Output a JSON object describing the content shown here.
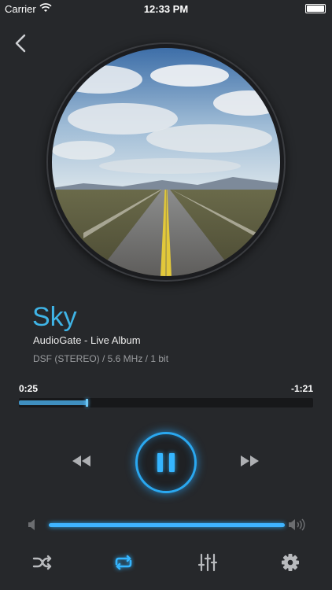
{
  "status_bar": {
    "carrier": "Carrier",
    "time": "12:33 PM",
    "wifi_icon": "wifi-icon",
    "battery_icon": "battery-icon"
  },
  "nav": {
    "back_icon": "chevron-left-icon"
  },
  "track": {
    "title": "Sky",
    "album": "AudioGate - Live Album",
    "format": "DSF (STEREO) / 5.6 MHz / 1 bit"
  },
  "playback": {
    "elapsed": "0:25",
    "remaining": "-1:21",
    "progress_fraction": 0.23,
    "state_icon": "pause-icon"
  },
  "volume": {
    "level_fraction": 1.0
  },
  "controls": {
    "rewind_icon": "rewind-icon",
    "forward_icon": "fast-forward-icon",
    "shuffle_icon": "shuffle-icon",
    "repeat_icon": "repeat-icon",
    "equalizer_icon": "equalizer-icon",
    "settings_icon": "gear-icon"
  },
  "colors": {
    "accent": "#3fb4e6",
    "background": "#26282b",
    "active_control": "#35b5ff"
  }
}
